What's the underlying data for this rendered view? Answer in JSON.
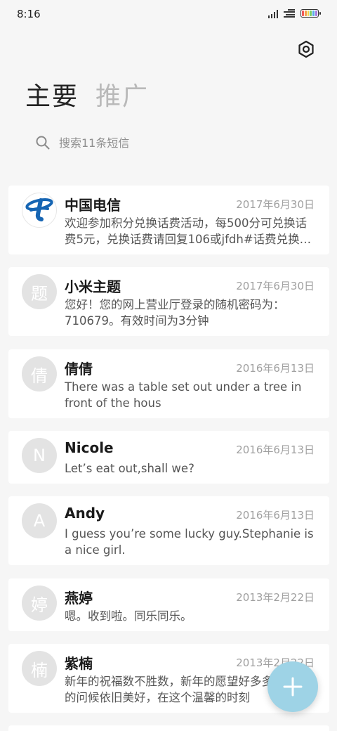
{
  "status_bar": {
    "time": "8:16",
    "battery_colors": [
      "#f05a5a",
      "#f5a14a",
      "#f2d64b",
      "#7ccd6a",
      "#5aaee8",
      "#a77ae0"
    ]
  },
  "header": {
    "settings_icon": "gear-hexagon-icon",
    "tabs": [
      {
        "label": "主要",
        "active": true
      },
      {
        "label": "推广",
        "active": false
      }
    ]
  },
  "search": {
    "placeholder": "搜索11条短信",
    "icon": "search-icon"
  },
  "conversations": [
    {
      "avatar": "",
      "avatar_type": "china-telecom-logo",
      "name": "中国电信",
      "date": "2017年6月30日",
      "preview": "欢迎参加积分兑换话费活动，每500分可兑换话费5元，兑换话费请回复106或jfdh#话费兑换代码"
    },
    {
      "avatar": "题",
      "name": "小米主题",
      "date": "2017年6月30日",
      "preview": "您好！您的网上营业厅登录的随机密码为：710679。有效时间为3分钟"
    },
    {
      "avatar": "倩",
      "name": "倩倩",
      "date": "2016年6月13日",
      "preview": "There was a table set out under a tree in front of the hous"
    },
    {
      "avatar": "N",
      "name": "Nicole",
      "date": "2016年6月13日",
      "preview": "Let’s eat out,shall we?"
    },
    {
      "avatar": "A",
      "name": "Andy",
      "date": "2016年6月13日",
      "preview": "I guess you’re some lucky guy.Stephanie is a nice girl."
    },
    {
      "avatar": "婷",
      "name": "燕婷",
      "date": "2013年2月22日",
      "preview": "嗯。收到啦。同乐同乐。"
    },
    {
      "avatar": "楠",
      "name": "紫楠",
      "date": "2013年2月22日",
      "preview": "新年的祝福数不胜数，新年的愿望好多多，新年的问候依旧美好，在这个温馨的时刻"
    }
  ],
  "fab": {
    "icon": "plus-icon",
    "color": "#9ed3e6"
  }
}
